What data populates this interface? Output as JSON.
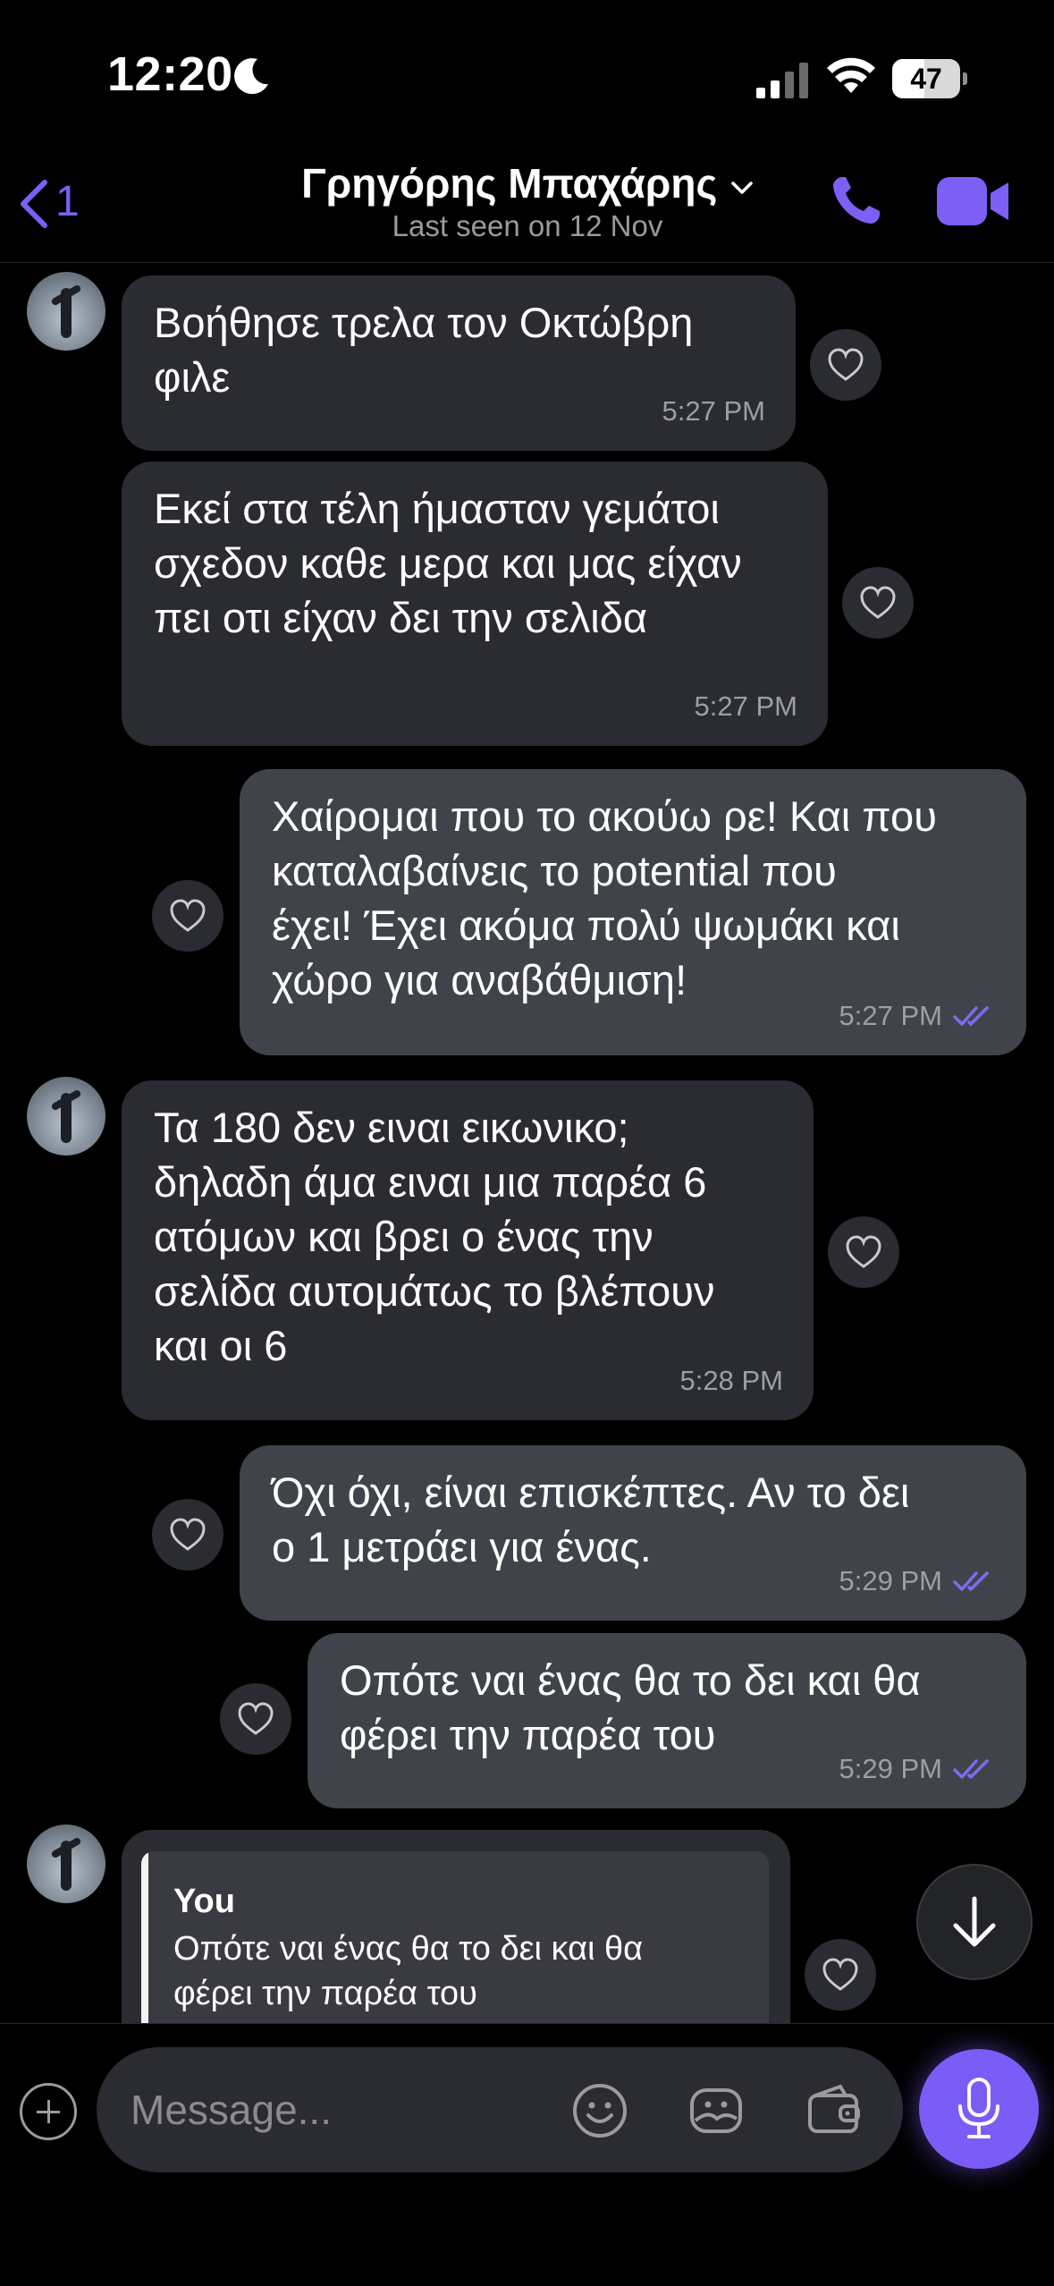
{
  "status_bar": {
    "time": "12:20",
    "battery": "47",
    "battery_level": 0.47
  },
  "header": {
    "back_count": "1",
    "contact_name": "Γρηγόρης Μπαχάρης",
    "last_seen": "Last seen on 12 Nov"
  },
  "colors": {
    "accent": "#7b5cf7",
    "incoming_bubble": "#2b2c32",
    "outgoing_bubble": "#41434b",
    "read_ticks": "#7d6bf0"
  },
  "messages": [
    {
      "direction": "in",
      "text": "Βοήθησε τρελα τον Οκτώβρη\nφιλε",
      "time": "5:27 PM"
    },
    {
      "direction": "in",
      "text": "Εκεί στα τέλη ήμασταν γεμάτοι\nσχεδον καθε μερα και μας είχαν\nπει οτι είχαν δει την σελιδα",
      "time": "5:27 PM"
    },
    {
      "direction": "out",
      "text": "Χαίρομαι που το ακούω ρε! Και που\nκαταλαβαίνεις το potential που\nέχει! Έχει ακόμα πολύ ψωμάκι και\nχώρο για αναβάθμιση!",
      "time": "5:27 PM"
    },
    {
      "direction": "in",
      "text": "Τα 180 δεν ειναι εικωνικο;\nδηλαδη άμα ειναι μια παρέα 6\nατόμων και βρει ο ένας την\nσελίδα αυτομάτως το βλέπουν\nκαι οι 6",
      "time": "5:28 PM"
    },
    {
      "direction": "out",
      "text": "Όχι όχι, είναι επισκέπτες. Αν το δει\nο 1 μετράει για ένας.",
      "time": "5:29 PM"
    },
    {
      "direction": "out",
      "text": "Οπότε ναι ένας θα το δει και θα\nφέρει την παρέα του",
      "time": "5:29 PM"
    }
  ],
  "reply": {
    "author": "You",
    "quoted_text": "Οπότε ναι ένας θα το δει και θα\nφέρει την παρέα του"
  },
  "composer": {
    "placeholder": "Message..."
  },
  "icons": {
    "back": "chevron-left-icon",
    "call": "phone-icon",
    "video": "video-camera-icon",
    "like": "heart-icon",
    "read": "double-check-icon",
    "scroll": "arrow-down-icon",
    "attach": "plus-icon",
    "emoji": "smiley-icon",
    "sticker": "sticker-icon",
    "wallet": "wallet-icon",
    "mic": "microphone-icon"
  }
}
